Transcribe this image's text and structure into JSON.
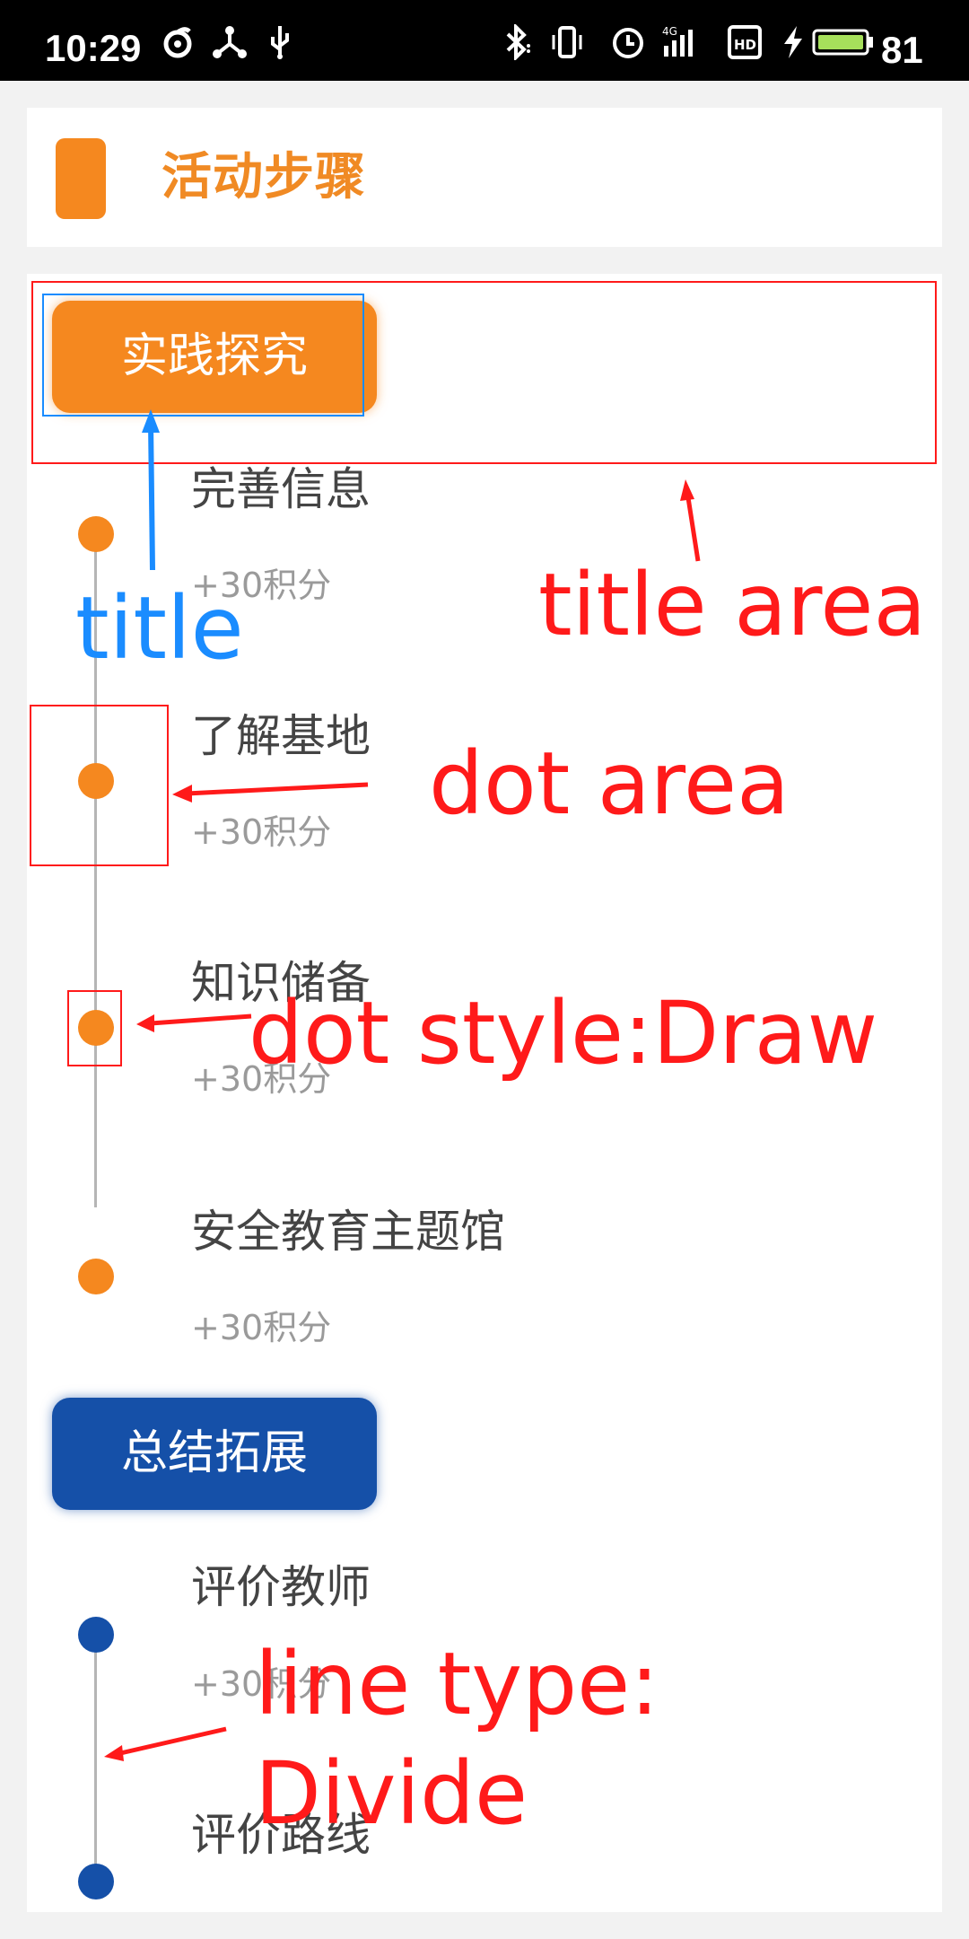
{
  "status_bar": {
    "time": "10:29",
    "battery": "81",
    "left_icons": [
      "notification-icon",
      "share-icon",
      "usb-icon"
    ],
    "right_icons": [
      "bluetooth-icon",
      "vibrate-icon",
      "alarm-icon",
      "signal-4g-icon",
      "hd-icon",
      "charging-icon",
      "battery-icon"
    ]
  },
  "header": {
    "title": "活动步骤",
    "accent": "#f5881f"
  },
  "sections": [
    {
      "title": "实践探究",
      "color": "#f5881f",
      "items": [
        {
          "name": "完善信息",
          "points": "+30积分"
        },
        {
          "name": "了解基地",
          "points": "+30积分"
        },
        {
          "name": "知识储备",
          "points": "+30积分"
        },
        {
          "name": "安全教育主题馆",
          "points": "+30积分"
        }
      ]
    },
    {
      "title": "总结拓展",
      "color": "#1550a8",
      "items": [
        {
          "name": "评价教师",
          "points": "+30积分"
        },
        {
          "name": "评价路线",
          "points": ""
        }
      ]
    }
  ],
  "annotations": {
    "title": "title",
    "title_area": "title area",
    "dot_area": "dot area",
    "dot_style": "dot style:Draw",
    "line_type_1": "line type:",
    "line_type_2": "Divide",
    "red": "#ff1a1a",
    "blue": "#1a8cff"
  }
}
